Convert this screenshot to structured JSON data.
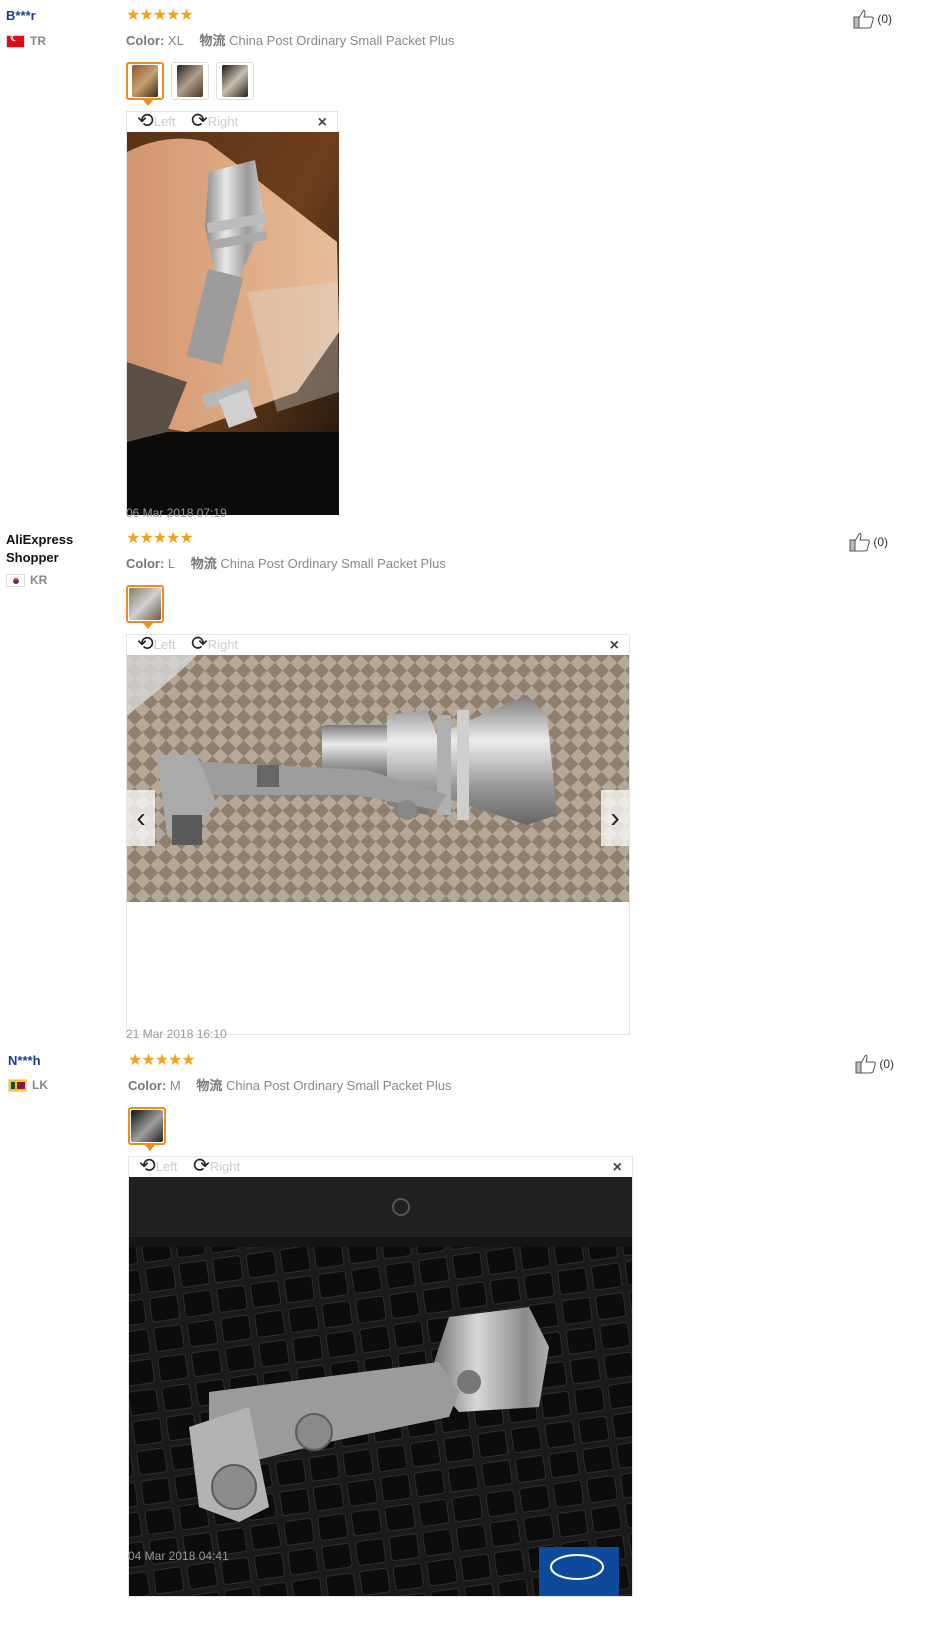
{
  "reviews": [
    {
      "user": "B***r",
      "country": "TR",
      "stars": "★★★★★",
      "color_label": "Color:",
      "color_value": "XL",
      "ship_label": "物流",
      "ship_value": "China Post Ordinary Small Packet Plus",
      "likes": "(0)",
      "rotate_left": "Left",
      "rotate_right": "Right",
      "close": "×",
      "date": "06 Mar 2018 07:19"
    },
    {
      "user": "AliExpress Shopper",
      "country": "KR",
      "stars": "★★★★★",
      "color_label": "Color:",
      "color_value": "L",
      "ship_label": "物流",
      "ship_value": "China Post Ordinary Small Packet Plus",
      "likes": "(0)",
      "rotate_left": "Left",
      "rotate_right": "Right",
      "close": "×",
      "prev": "‹",
      "next": "›",
      "date": "21 Mar 2018 16:10"
    },
    {
      "user": "N***h",
      "country": "LK",
      "stars": "★★★★★",
      "color_label": "Color:",
      "color_value": "M",
      "ship_label": "物流",
      "ship_value": "China Post Ordinary Small Packet Plus",
      "likes": "(0)",
      "rotate_left": "Left",
      "rotate_right": "Right",
      "close": "×",
      "date": "04 Mar 2018 04:41"
    }
  ],
  "colors": {
    "star": "#f5a21b",
    "username": "#1a3e8c",
    "thumb_active_border": "#f08a24"
  },
  "icons": [
    "thumbs-up-icon",
    "rotate-left-icon",
    "rotate-right-icon",
    "close-icon",
    "chevron-left-icon",
    "chevron-right-icon"
  ]
}
